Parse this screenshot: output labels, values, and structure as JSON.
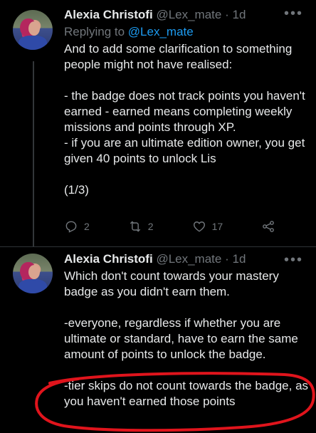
{
  "tweets": [
    {
      "author": "Alexia Christofi",
      "handle": "@Lex_mate",
      "dot": "·",
      "time": "1d",
      "replying_prefix": "Replying to ",
      "replying_to": "@Lex_mate",
      "text": "And to add some clarification to something people might not have realised:\n\n- the badge does not track points you haven't earned - earned means completing weekly missions and points through XP.\n- if you are an ultimate edition owner, you get given 40 points to unlock Lis\n\n(1/3)",
      "reply_count": "2",
      "retweet_count": "2",
      "like_count": "17",
      "more_glyph": "•••"
    },
    {
      "author": "Alexia Christofi",
      "handle": "@Lex_mate",
      "dot": "·",
      "time": "1d",
      "text": "Which don't count towards your mastery badge as you didn't earn them.\n\n-everyone, regardless if whether you are ultimate or standard, have to earn the same amount of points to unlock the badge.\n\n-tier skips do not count towards the badge, as you haven't earned those points",
      "more_glyph": "•••"
    }
  ],
  "colors": {
    "background": "#000000",
    "text": "#e7e9ea",
    "muted": "#71767b",
    "link": "#1d9bf0",
    "annotation": "#e0141c"
  },
  "icons": [
    "reply-icon",
    "retweet-icon",
    "like-icon",
    "share-icon",
    "more-icon"
  ]
}
